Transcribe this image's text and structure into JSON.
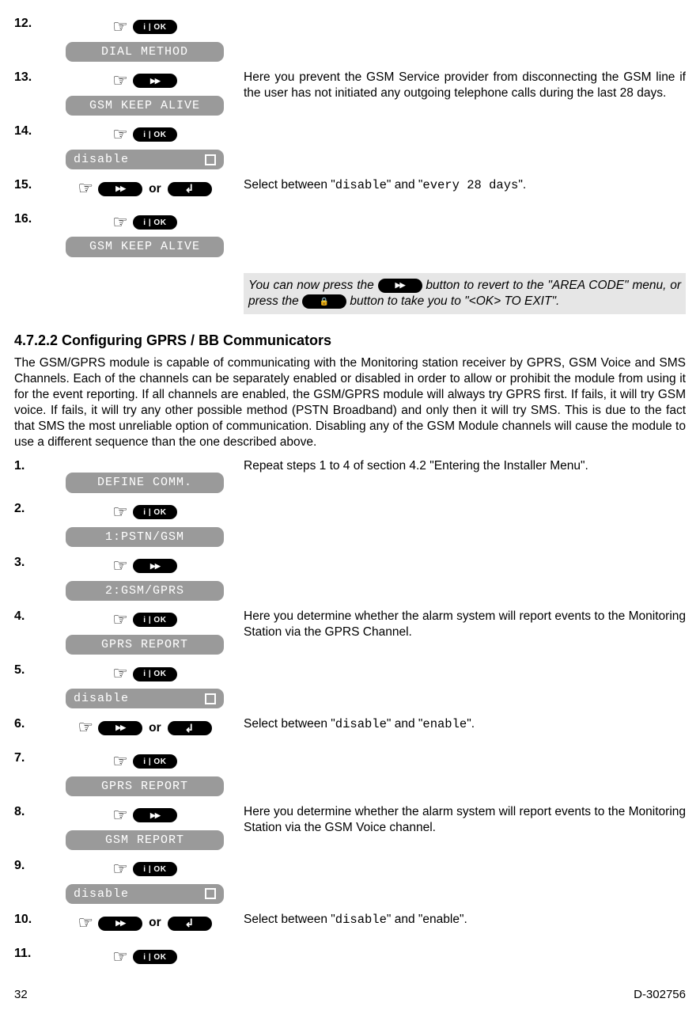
{
  "footer": {
    "page": "32",
    "doc": "D-302756"
  },
  "section": {
    "heading": "4.7.2.2 Configuring GPRS / BB Communicators",
    "body": "The GSM/GPRS module is capable of communicating with the Monitoring station receiver by GPRS, GSM Voice and SMS Channels. Each of the channels can be separately enabled or disabled in order to allow or prohibit the module from using it for the event reporting. If all channels are enabled, the GSM/GPRS module will always try GPRS first. If fails, it will try GSM voice. If fails, it will try any other possible method (PSTN Broadband) and only then it will try SMS. This is due to the fact that SMS the most unreliable option of communication. Disabling any of the GSM Module channels will cause the module to use a different sequence than the one described above."
  },
  "labels": {
    "ok": "i | OK",
    "or": "or"
  },
  "stepsA": {
    "s12": {
      "num": "12.",
      "display": "DIAL METHOD"
    },
    "s13": {
      "num": "13.",
      "display": "GSM KEEP ALIVE",
      "desc": "Here you prevent the GSM Service provider from disconnecting the GSM line if the user has not initiated any outgoing telephone calls during the last 28 days."
    },
    "s14": {
      "num": "14.",
      "display": "disable"
    },
    "s15": {
      "num": "15.",
      "desc_pre": "Select between \"",
      "opt1": "disable",
      "mid": "\" and \"",
      "opt2": "every 28 days",
      "desc_post": "\"."
    },
    "s16": {
      "num": "16.",
      "display": "GSM KEEP ALIVE"
    },
    "note": {
      "p1": "You can now press the ",
      "p2": " button to revert to the \"AREA CODE\" menu, or press the  ",
      "p3": " button to take you to \"<OK> TO EXIT\"."
    }
  },
  "stepsB": {
    "s1": {
      "num": "1.",
      "display": "DEFINE COMM.",
      "desc": "Repeat steps 1 to 4 of section 4.2 \"Entering the Installer Menu\"."
    },
    "s2": {
      "num": "2.",
      "display": "1:PSTN/GSM"
    },
    "s3": {
      "num": "3.",
      "display": "2:GSM/GPRS"
    },
    "s4": {
      "num": "4.",
      "display": "GPRS REPORT",
      "desc": "Here you determine whether the alarm system will report events to the Monitoring Station via the GPRS Channel."
    },
    "s5": {
      "num": "5.",
      "display": "disable"
    },
    "s6": {
      "num": "6.",
      "desc_pre": "Select between \"",
      "opt1": "disable",
      "mid": "\" and \"",
      "opt2": "enable",
      "desc_post": "\"."
    },
    "s7": {
      "num": "7.",
      "display": "GPRS REPORT"
    },
    "s8": {
      "num": "8.",
      "display": "GSM REPORT",
      "desc": "Here you determine whether the alarm system will report events to the Monitoring Station via the GSM Voice channel."
    },
    "s9": {
      "num": "9.",
      "display": "disable"
    },
    "s10": {
      "num": "10.",
      "desc_pre": "Select between \"",
      "opt1": "disable",
      "mid": "\" and \"enable\"."
    },
    "s11": {
      "num": "11."
    }
  }
}
